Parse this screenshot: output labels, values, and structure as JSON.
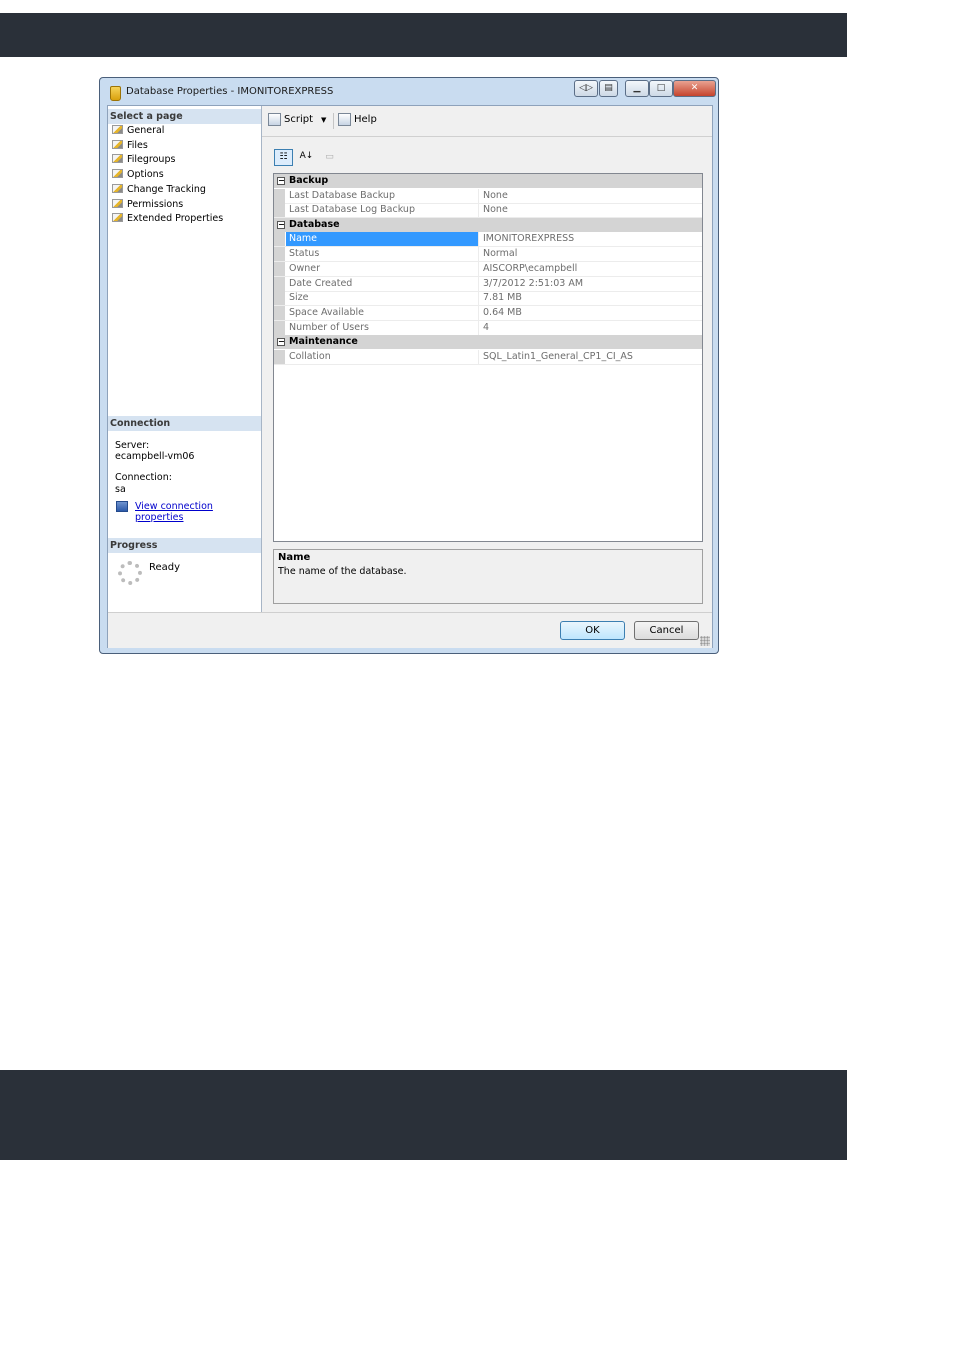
{
  "window": {
    "title": "Database Properties - IMONITOREXPRESS",
    "buttons": {
      "back": "◁▷",
      "doc": "▤",
      "min": "▁",
      "max": "□",
      "close": "✕"
    }
  },
  "left": {
    "select_header": "Select a page",
    "pages": [
      "General",
      "Files",
      "Filegroups",
      "Options",
      "Change Tracking",
      "Permissions",
      "Extended Properties"
    ],
    "connection_header": "Connection",
    "server_label": "Server:",
    "server_value": "ecampbell-vm06",
    "connection_label": "Connection:",
    "connection_value": "sa",
    "view_link": "View connection properties",
    "progress_header": "Progress",
    "progress_status": "Ready"
  },
  "toolbar": {
    "script": "Script",
    "help": "Help"
  },
  "grid_toolbar": {
    "categorized": "☷",
    "alpha": "A↓",
    "pages": "▭"
  },
  "grid": {
    "categories": [
      {
        "name": "Backup",
        "rows": [
          {
            "name": "Last Database Backup",
            "value": "None"
          },
          {
            "name": "Last Database Log Backup",
            "value": "None"
          }
        ]
      },
      {
        "name": "Database",
        "rows": [
          {
            "name": "Name",
            "value": "IMONITOREXPRESS"
          },
          {
            "name": "Status",
            "value": "Normal"
          },
          {
            "name": "Owner",
            "value": "AISCORP\\ecampbell"
          },
          {
            "name": "Date Created",
            "value": "3/7/2012 2:51:03 AM"
          },
          {
            "name": "Size",
            "value": "7.81 MB"
          },
          {
            "name": "Space Available",
            "value": "0.64 MB"
          },
          {
            "name": "Number of Users",
            "value": "4"
          }
        ]
      },
      {
        "name": "Maintenance",
        "rows": [
          {
            "name": "Collation",
            "value": "SQL_Latin1_General_CP1_CI_AS"
          }
        ]
      }
    ],
    "selected": "Name"
  },
  "description": {
    "title": "Name",
    "text": "The name of the database."
  },
  "footer": {
    "ok": "OK",
    "cancel": "Cancel"
  },
  "colors": {
    "selection": "#3399ff",
    "dark_band": "#2a3039",
    "link": "#0000cc"
  }
}
